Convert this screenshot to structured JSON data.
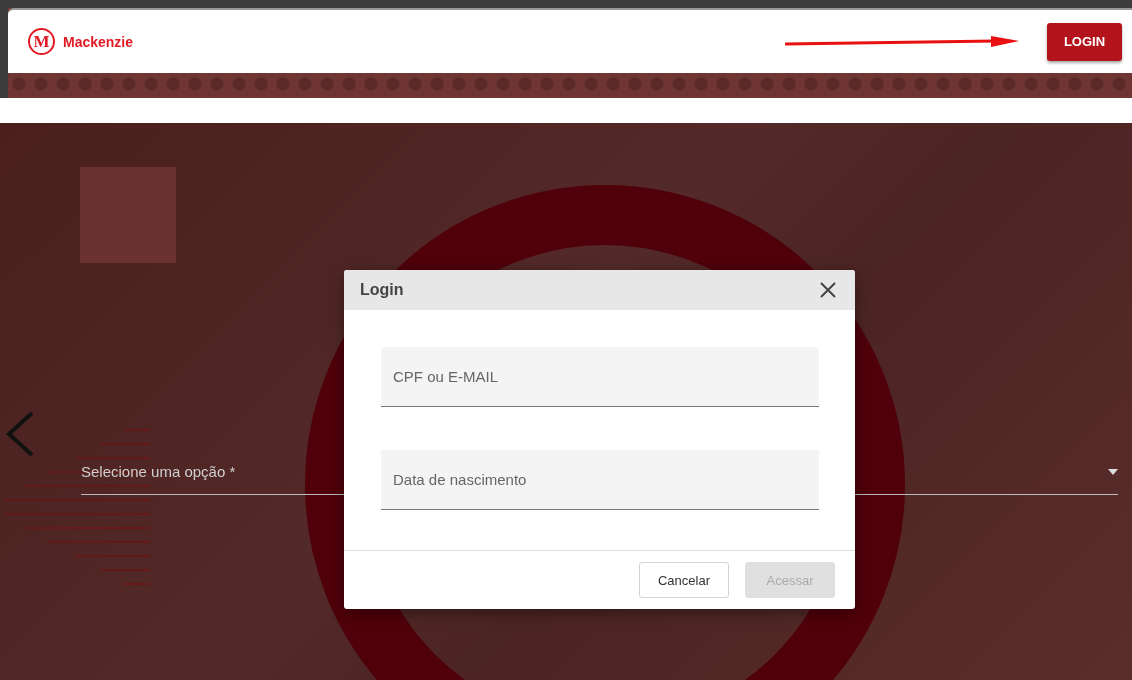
{
  "header": {
    "logo_mark": "M",
    "logo_text": "Mackenzie",
    "login_button": "LOGIN"
  },
  "page": {
    "select": {
      "placeholder": "Selecione uma opção *"
    }
  },
  "dialog": {
    "title": "Login",
    "fields": [
      {
        "placeholder": "CPF ou E-MAIL"
      },
      {
        "placeholder": "Data de nascimento"
      }
    ],
    "buttons": [
      {
        "label": "Cancelar",
        "disabled": false
      },
      {
        "label": "Acessar",
        "disabled": true
      }
    ]
  }
}
